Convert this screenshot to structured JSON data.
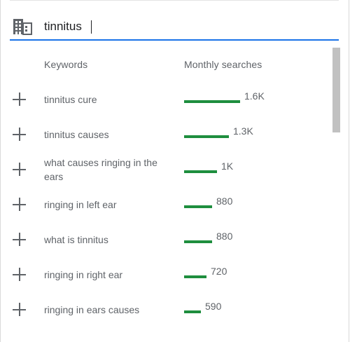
{
  "search": {
    "value": "tinnitus",
    "icon": "building-icon"
  },
  "columns": {
    "keywords": "Keywords",
    "searches": "Monthly searches"
  },
  "colors": {
    "accent": "#1a73e8",
    "bar": "#1e8e3e"
  },
  "rows": [
    {
      "keyword": "tinnitus cure",
      "searches": "1.6K",
      "bar_fraction": 1.0
    },
    {
      "keyword": "tinnitus causes",
      "searches": "1.3K",
      "bar_fraction": 0.8
    },
    {
      "keyword": "what causes ringing in the ears",
      "searches": "1K",
      "bar_fraction": 0.59
    },
    {
      "keyword": "ringing in left ear",
      "searches": "880",
      "bar_fraction": 0.5
    },
    {
      "keyword": "what is tinnitus",
      "searches": "880",
      "bar_fraction": 0.5
    },
    {
      "keyword": "ringing in right ear",
      "searches": "720",
      "bar_fraction": 0.4
    },
    {
      "keyword": "ringing in ears causes",
      "searches": "590",
      "bar_fraction": 0.3
    }
  ]
}
